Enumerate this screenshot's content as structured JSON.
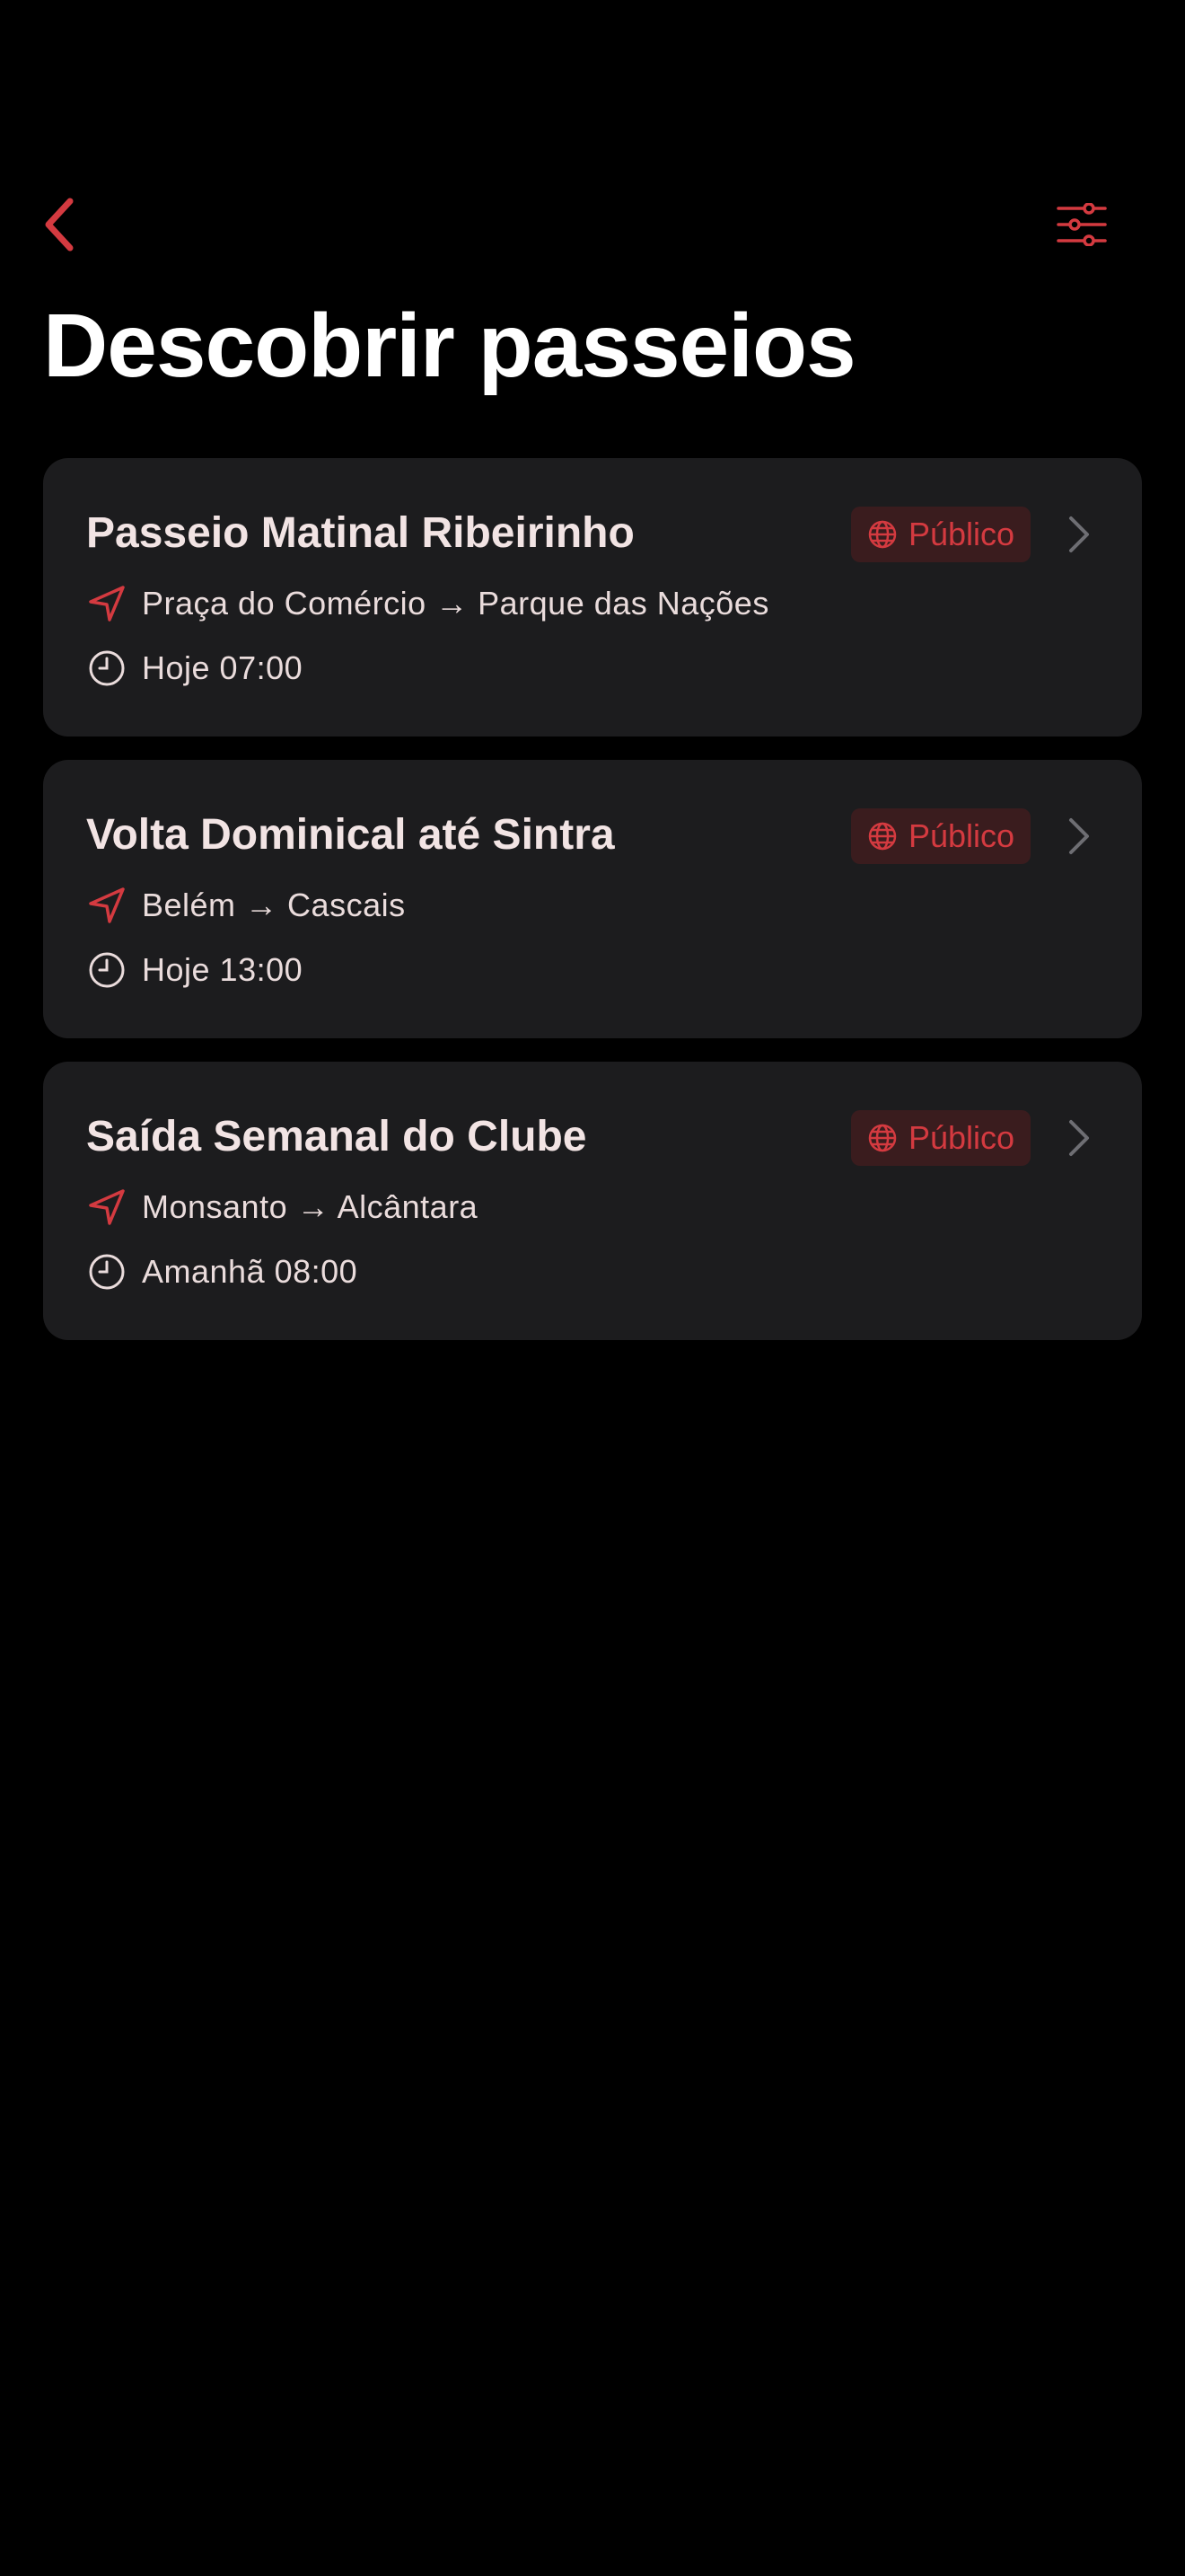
{
  "colors": {
    "accent": "#D43A40",
    "background": "#000000",
    "card": "#1C1C1E",
    "badge_background": "#3A1C1E",
    "text_primary": "#F2E4E4",
    "text_secondary": "#EADCDC",
    "chevron": "#6E6E73"
  },
  "nav": {
    "back_icon": "chevron-left-icon",
    "filter_icon": "sliders-icon"
  },
  "page": {
    "title": "Descobrir passeios"
  },
  "rides": [
    {
      "title": "Passeio Matinal Ribeirinho",
      "visibility": "Público",
      "route": "Praça do Comércio → Parque das Nações",
      "time": "Hoje 07:00"
    },
    {
      "title": "Volta Dominical até Sintra",
      "visibility": "Público",
      "route": "Belém → Cascais",
      "time": "Hoje 13:00"
    },
    {
      "title": "Saída Semanal do Clube",
      "visibility": "Público",
      "route": "Monsanto → Alcântara",
      "time": "Amanhã 08:00"
    }
  ]
}
